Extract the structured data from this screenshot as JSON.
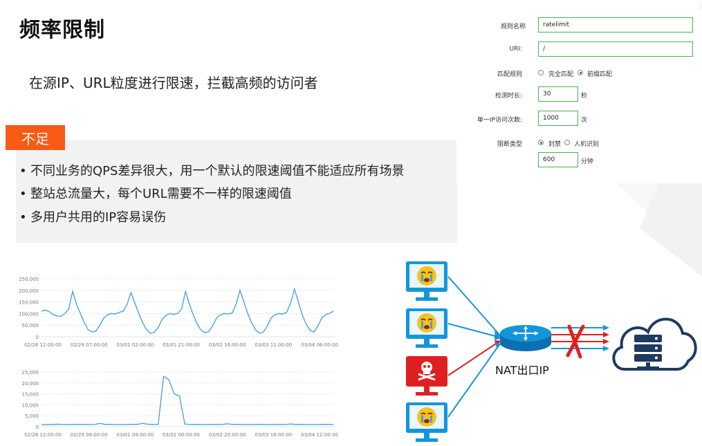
{
  "slide": {
    "title": "频率限制",
    "subtitle": "在源IP、URL粒度进行限速，拦截高频的访问者",
    "badge": "不足",
    "bullets": [
      "不同业务的QPS差异很大，用一个默认的限速阈值不能适应所有场景",
      "整站总流量大，每个URL需要不一样的限速阈值",
      "多用户共用的IP容易误伤"
    ]
  },
  "form": {
    "rule_name_label": "规则名称",
    "rule_name_value": "ratelimit",
    "uri_label": "URI:",
    "uri_value": "/",
    "match_label": "匹配规则",
    "match_options": [
      "完全匹配",
      "前缀匹配"
    ],
    "match_selected": "前缀匹配",
    "duration_label": "检测时长:",
    "duration_value": "30",
    "duration_unit": "秒",
    "count_label": "单一IP访问次数:",
    "count_value": "1000",
    "count_unit": "次",
    "block_label": "阻断类型",
    "block_options": [
      "封禁",
      "人机识别"
    ],
    "block_selected": "封禁",
    "block_duration_value": "600",
    "block_duration_unit": "分钟"
  },
  "chart_data": [
    {
      "type": "line",
      "ylim": [
        0,
        250000
      ],
      "yticks": [
        "250,000",
        "200,000",
        "150,000",
        "100,000",
        "50,000",
        "0"
      ],
      "xticks": [
        "02/28 12:00:00",
        "02/29 07:00:00",
        "03/01 02:00:00",
        "03/01 21:00:00",
        "03/02 16:00:00",
        "03/03 11:00:00",
        "03/04 06:00:00"
      ],
      "series": [
        {
          "values": [
            110000,
            115000,
            108000,
            95000,
            90000,
            88000,
            100000,
            120000,
            195000,
            140000,
            100000,
            60000,
            30000,
            20000,
            25000,
            50000,
            80000,
            95000,
            100000,
            98000,
            105000,
            110000,
            140000,
            190000,
            145000,
            100000,
            60000,
            30000,
            15000,
            20000,
            40000,
            75000,
            92000,
            100000,
            96000,
            100000,
            120000,
            195000,
            140000,
            95000,
            55000,
            28000,
            18000,
            22000,
            48000,
            80000,
            95000,
            100000,
            98000,
            102000,
            140000,
            200000,
            150000,
            100000,
            60000,
            30000,
            15000,
            20000,
            45000,
            80000,
            95000,
            100000,
            98000,
            105000,
            145000,
            205000,
            150000,
            95000,
            55000,
            28000,
            20000,
            45000,
            80000,
            95000,
            100000,
            110000
          ]
        }
      ]
    },
    {
      "type": "line",
      "ylim": [
        0,
        25000
      ],
      "yticks": [
        "25,000",
        "20,000",
        "15,000",
        "10,000",
        "5,000",
        "0"
      ],
      "xticks": [
        "02/28 12:00:00",
        "02/29 08:00:00",
        "03/01 04:00:00",
        "03/02 00:00:00",
        "03/02 20:00:00",
        "03/03 16:00:00",
        "03/04 12:00:00"
      ],
      "series": [
        {
          "values": [
            900,
            950,
            1000,
            1100,
            1000,
            950,
            1000,
            1050,
            1000,
            980,
            1000,
            1500,
            1000,
            1050,
            1000,
            980,
            1000,
            1050,
            1000,
            1500,
            1100,
            1000,
            1000,
            23000,
            21500,
            15000,
            14000,
            1200,
            1000,
            1050,
            1000,
            980,
            1000,
            1050,
            1000,
            1300,
            1000,
            1050,
            1000,
            980,
            1000,
            1050,
            1000,
            980,
            1000,
            1050,
            1000,
            1200,
            1000,
            1050,
            1000,
            980,
            1000,
            1050,
            1000,
            1000
          ]
        }
      ]
    }
  ],
  "diagram": {
    "nat_label": "NAT出口IP",
    "colors": {
      "blue": "#1296db",
      "red": "#e02020",
      "accent": "#f95a15",
      "form_border": "#4caf50"
    },
    "icons": [
      "crying-face-monitor-icon",
      "crying-face-monitor-icon",
      "skull-monitor-icon",
      "crying-face-monitor-icon",
      "router-icon",
      "blocked-x-icon",
      "cloud-server-icon"
    ]
  }
}
